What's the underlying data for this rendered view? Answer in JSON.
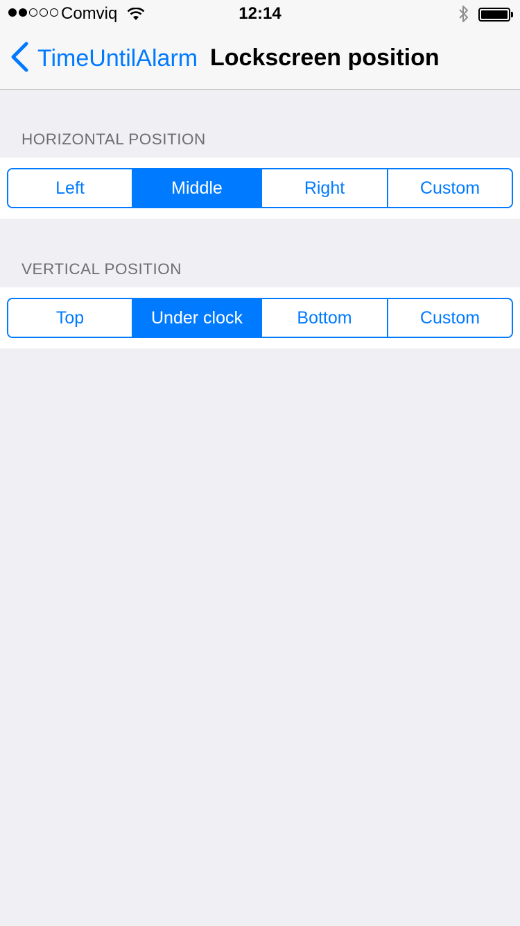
{
  "status_bar": {
    "signal": "●●○○○",
    "carrier": "Comviq",
    "time": "12:14"
  },
  "nav": {
    "back_label": "TimeUntilAlarm",
    "title": "Lockscreen position"
  },
  "horizontal": {
    "header": "HORIZONTAL POSITION",
    "segments": [
      "Left",
      "Middle",
      "Right",
      "Custom"
    ],
    "selected": "Middle"
  },
  "vertical": {
    "header": "VERTICAL POSITION",
    "segments": [
      "Top",
      "Under clock",
      "Bottom",
      "Custom"
    ],
    "selected": "Under clock"
  },
  "colors": {
    "accent": "#007aff",
    "background": "#efeff4"
  }
}
